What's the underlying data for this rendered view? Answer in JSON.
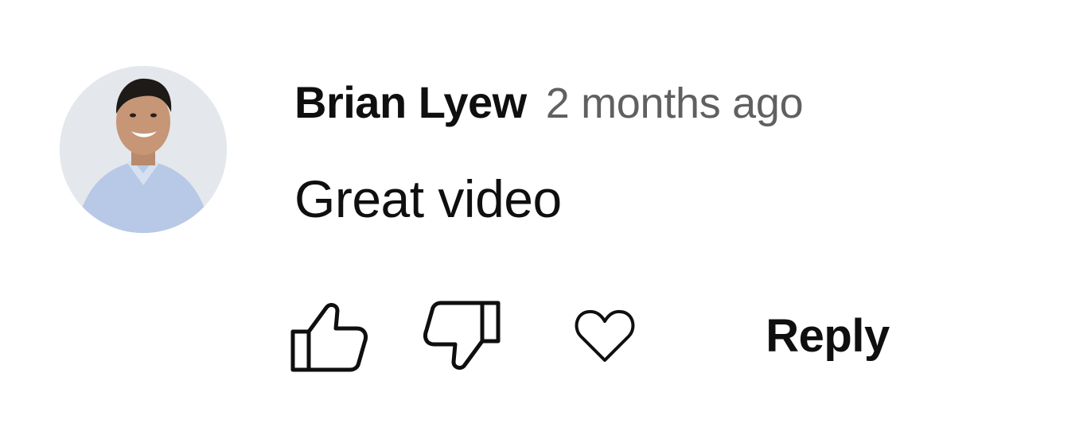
{
  "comment": {
    "author": "Brian Lyew",
    "timestamp": "2 months ago",
    "text": "Great video",
    "avatar_icon": "user-avatar-photo"
  },
  "actions": {
    "like_icon": "thumbs-up-icon",
    "dislike_icon": "thumbs-down-icon",
    "heart_icon": "heart-icon",
    "reply_label": "Reply"
  },
  "colors": {
    "text_primary": "#0f0f0f",
    "text_secondary": "#606060",
    "background": "#ffffff"
  }
}
